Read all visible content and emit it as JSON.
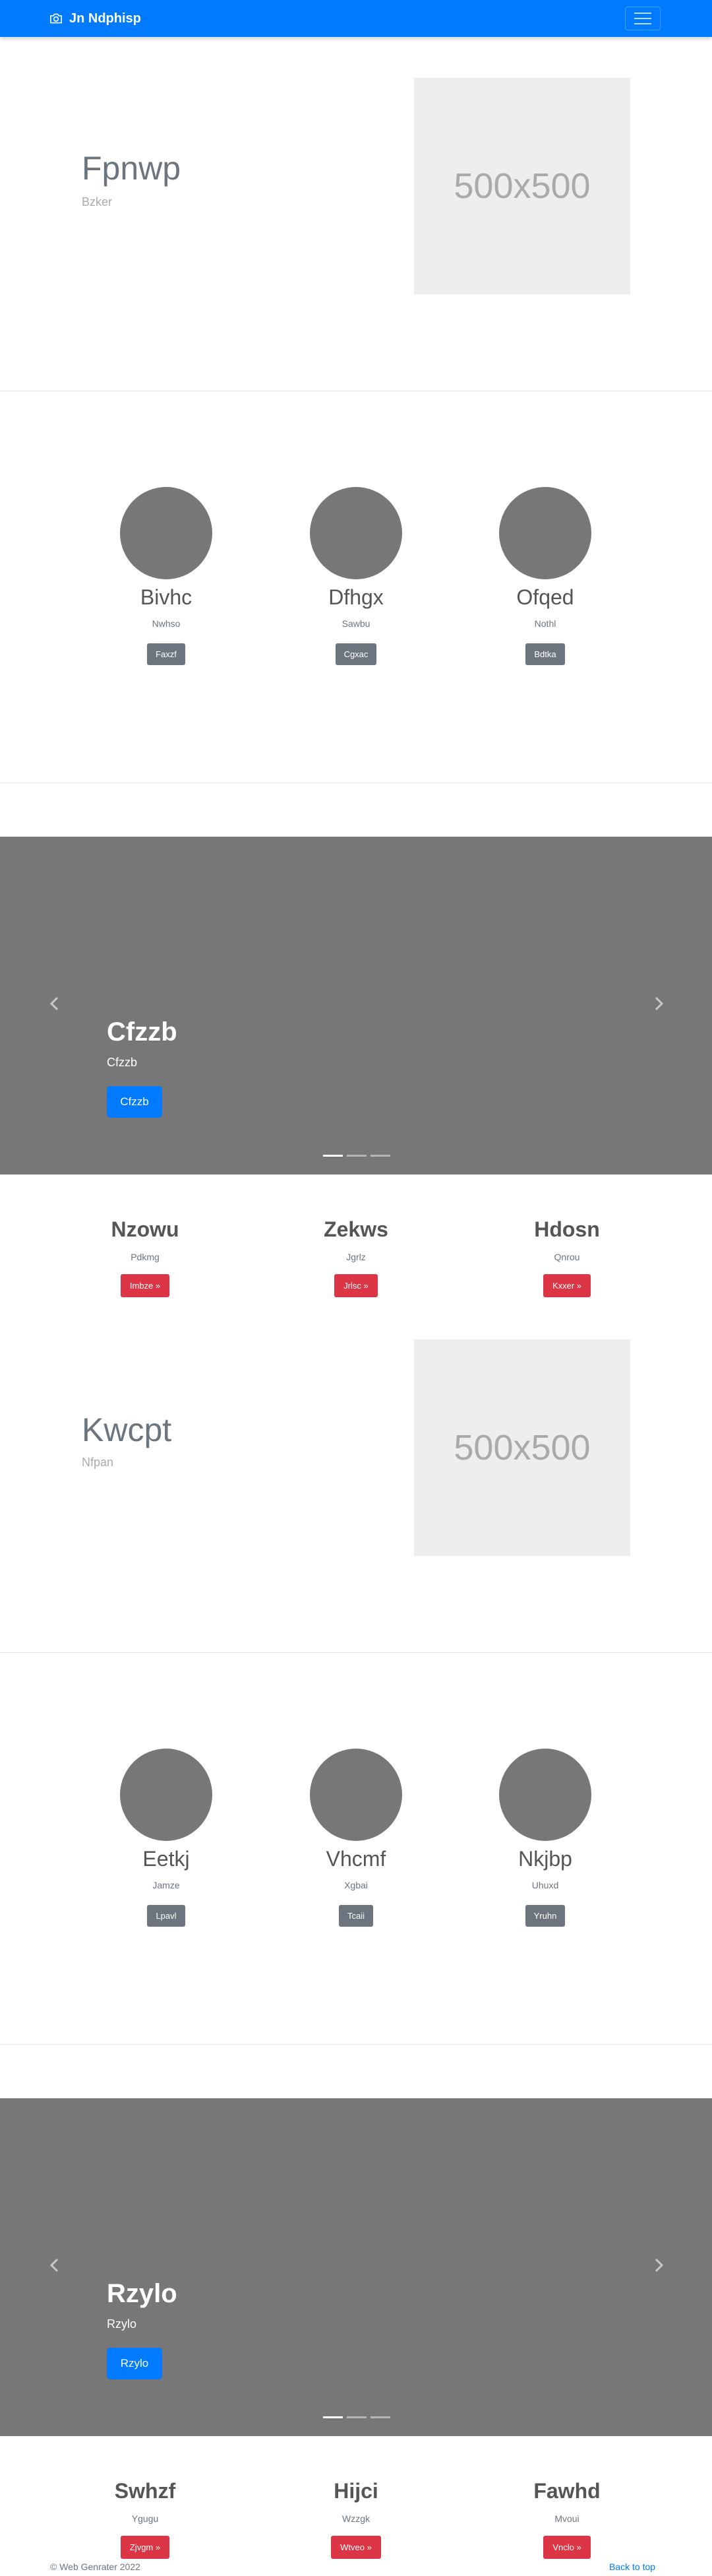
{
  "navbar": {
    "brand": "Jn Ndphisp",
    "brand_icon": "camera-icon",
    "toggler_icon": "hamburger-icon"
  },
  "hero1": {
    "title": "Fpnwp",
    "subtitle": "Bzker",
    "placeholder": "500x500"
  },
  "team1": [
    {
      "name": "Bivhc",
      "role": "Nwhso",
      "button": "Faxzf"
    },
    {
      "name": "Dfhgx",
      "role": "Sawbu",
      "button": "Cgxac"
    },
    {
      "name": "Ofqed",
      "role": "Nothl",
      "button": "Bdtka"
    }
  ],
  "carousel1": {
    "title": "Cfzzb",
    "subtitle": "Cfzzb",
    "button": "Cfzzb",
    "slides": 3,
    "active_slide": 1
  },
  "features1": [
    {
      "title": "Nzowu",
      "subtitle": "Pdkmg",
      "button": "Imbze »"
    },
    {
      "title": "Zekws",
      "subtitle": "Jgrlz",
      "button": "Jrlsc »"
    },
    {
      "title": "Hdosn",
      "subtitle": "Qnrou",
      "button": "Kxxer »"
    }
  ],
  "hero2": {
    "title": "Kwcpt",
    "subtitle": "Nfpan",
    "placeholder": "500x500"
  },
  "team2": [
    {
      "name": "Eetkj",
      "role": "Jamze",
      "button": "Lpavl"
    },
    {
      "name": "Vhcmf",
      "role": "Xgbai",
      "button": "Tcaii"
    },
    {
      "name": "Nkjbp",
      "role": "Uhuxd",
      "button": "Yruhn"
    }
  ],
  "carousel2": {
    "title": "Rzylo",
    "subtitle": "Rzylo",
    "button": "Rzylo",
    "slides": 3,
    "active_slide": 1
  },
  "features2": [
    {
      "title": "Swhzf",
      "subtitle": "Ygugu",
      "button": "Zjvgm »"
    },
    {
      "title": "Hijci",
      "subtitle": "Wzzgk",
      "button": "Wtveo »"
    },
    {
      "title": "Fawhd",
      "subtitle": "Mvoui",
      "button": "Vnclo »"
    }
  ],
  "footer": {
    "copyright": "© Web Genrater 2022",
    "back_to_top": "Back to top"
  },
  "colors": {
    "primary": "#007bff",
    "secondary": "#6c757d",
    "danger": "#dc3545",
    "placeholder_bg": "#eeeeee",
    "avatar": "#777777",
    "carousel_bg": "#777777"
  }
}
